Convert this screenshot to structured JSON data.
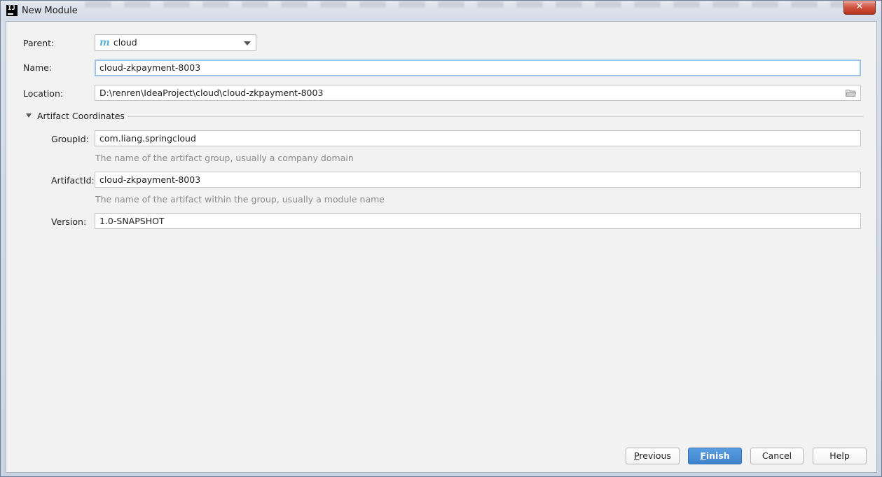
{
  "window": {
    "title": "New Module",
    "close_label": "✕"
  },
  "form": {
    "parent_label": "Parent:",
    "parent_value": "cloud",
    "name_label": "Name:",
    "name_value": "cloud-zkpayment-8003",
    "location_label": "Location:",
    "location_value": "D:\\renren\\IdeaProject\\cloud\\cloud-zkpayment-8003"
  },
  "artifact": {
    "section_label": "Artifact Coordinates",
    "group_label": "GroupId:",
    "group_value": "com.liang.springcloud",
    "group_hint": "The name of the artifact group, usually a company domain",
    "artifact_label": "ArtifactId:",
    "artifact_value": "cloud-zkpayment-8003",
    "artifact_hint": "The name of the artifact within the group, usually a module name",
    "version_label": "Version:",
    "version_value": "1.0-SNAPSHOT"
  },
  "buttons": {
    "previous_first": "P",
    "previous_rest": "revious",
    "finish_first": "F",
    "finish_rest": "inish",
    "cancel": "Cancel",
    "help": "Help"
  },
  "icons": {
    "parent_module": "maven-m-icon",
    "location_browse": "folder-icon",
    "section_toggle": "collapse-triangle-icon",
    "combo_dropdown": "chevron-down-icon"
  }
}
